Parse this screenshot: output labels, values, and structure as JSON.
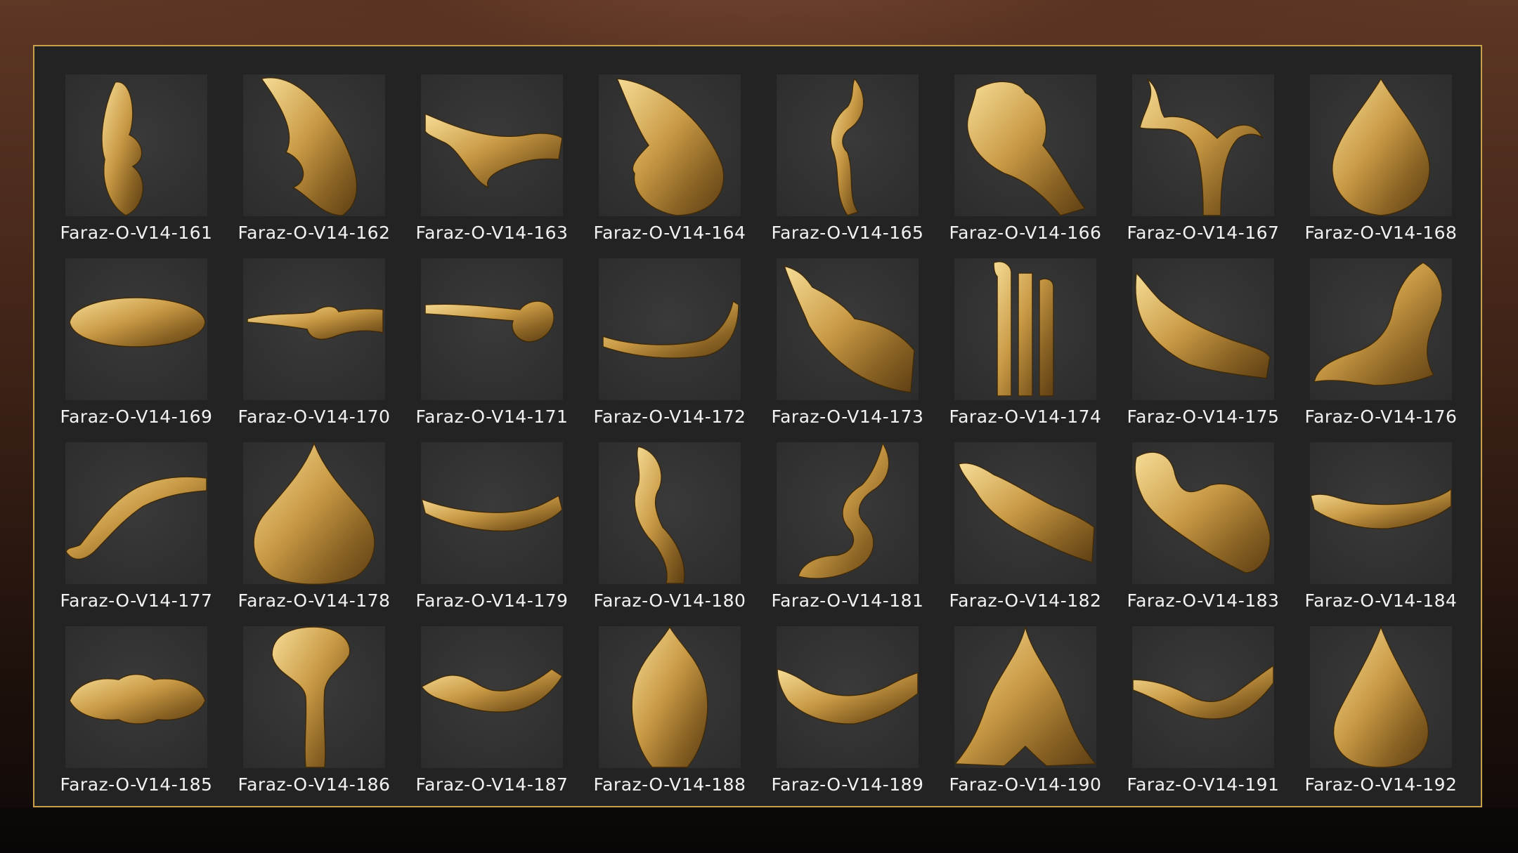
{
  "gallery": {
    "items": [
      {
        "label": "Faraz-O-V14-161",
        "icon": "ornament-161-icon"
      },
      {
        "label": "Faraz-O-V14-162",
        "icon": "ornament-162-icon"
      },
      {
        "label": "Faraz-O-V14-163",
        "icon": "ornament-163-icon"
      },
      {
        "label": "Faraz-O-V14-164",
        "icon": "ornament-164-icon"
      },
      {
        "label": "Faraz-O-V14-165",
        "icon": "ornament-165-icon"
      },
      {
        "label": "Faraz-O-V14-166",
        "icon": "ornament-166-icon"
      },
      {
        "label": "Faraz-O-V14-167",
        "icon": "ornament-167-icon"
      },
      {
        "label": "Faraz-O-V14-168",
        "icon": "ornament-168-icon"
      },
      {
        "label": "Faraz-O-V14-169",
        "icon": "ornament-169-icon"
      },
      {
        "label": "Faraz-O-V14-170",
        "icon": "ornament-170-icon"
      },
      {
        "label": "Faraz-O-V14-171",
        "icon": "ornament-171-icon"
      },
      {
        "label": "Faraz-O-V14-172",
        "icon": "ornament-172-icon"
      },
      {
        "label": "Faraz-O-V14-173",
        "icon": "ornament-173-icon"
      },
      {
        "label": "Faraz-O-V14-174",
        "icon": "ornament-174-icon"
      },
      {
        "label": "Faraz-O-V14-175",
        "icon": "ornament-175-icon"
      },
      {
        "label": "Faraz-O-V14-176",
        "icon": "ornament-176-icon"
      },
      {
        "label": "Faraz-O-V14-177",
        "icon": "ornament-177-icon"
      },
      {
        "label": "Faraz-O-V14-178",
        "icon": "ornament-178-icon"
      },
      {
        "label": "Faraz-O-V14-179",
        "icon": "ornament-179-icon"
      },
      {
        "label": "Faraz-O-V14-180",
        "icon": "ornament-180-icon"
      },
      {
        "label": "Faraz-O-V14-181",
        "icon": "ornament-181-icon"
      },
      {
        "label": "Faraz-O-V14-182",
        "icon": "ornament-182-icon"
      },
      {
        "label": "Faraz-O-V14-183",
        "icon": "ornament-183-icon"
      },
      {
        "label": "Faraz-O-V14-184",
        "icon": "ornament-184-icon"
      },
      {
        "label": "Faraz-O-V14-185",
        "icon": "ornament-185-icon"
      },
      {
        "label": "Faraz-O-V14-186",
        "icon": "ornament-186-icon"
      },
      {
        "label": "Faraz-O-V14-187",
        "icon": "ornament-187-icon"
      },
      {
        "label": "Faraz-O-V14-188",
        "icon": "ornament-188-icon"
      },
      {
        "label": "Faraz-O-V14-189",
        "icon": "ornament-189-icon"
      },
      {
        "label": "Faraz-O-V14-190",
        "icon": "ornament-190-icon"
      },
      {
        "label": "Faraz-O-V14-191",
        "icon": "ornament-191-icon"
      },
      {
        "label": "Faraz-O-V14-192",
        "icon": "ornament-192-icon"
      }
    ]
  },
  "colors": {
    "frame_border": "#c9a04a",
    "panel_bg": "#232323",
    "tile_bg": "#333333",
    "gold_light": "#f6dc96",
    "gold_mid": "#c99a45",
    "gold_dark": "#5e3f14",
    "label_text": "#f2f2f2"
  }
}
